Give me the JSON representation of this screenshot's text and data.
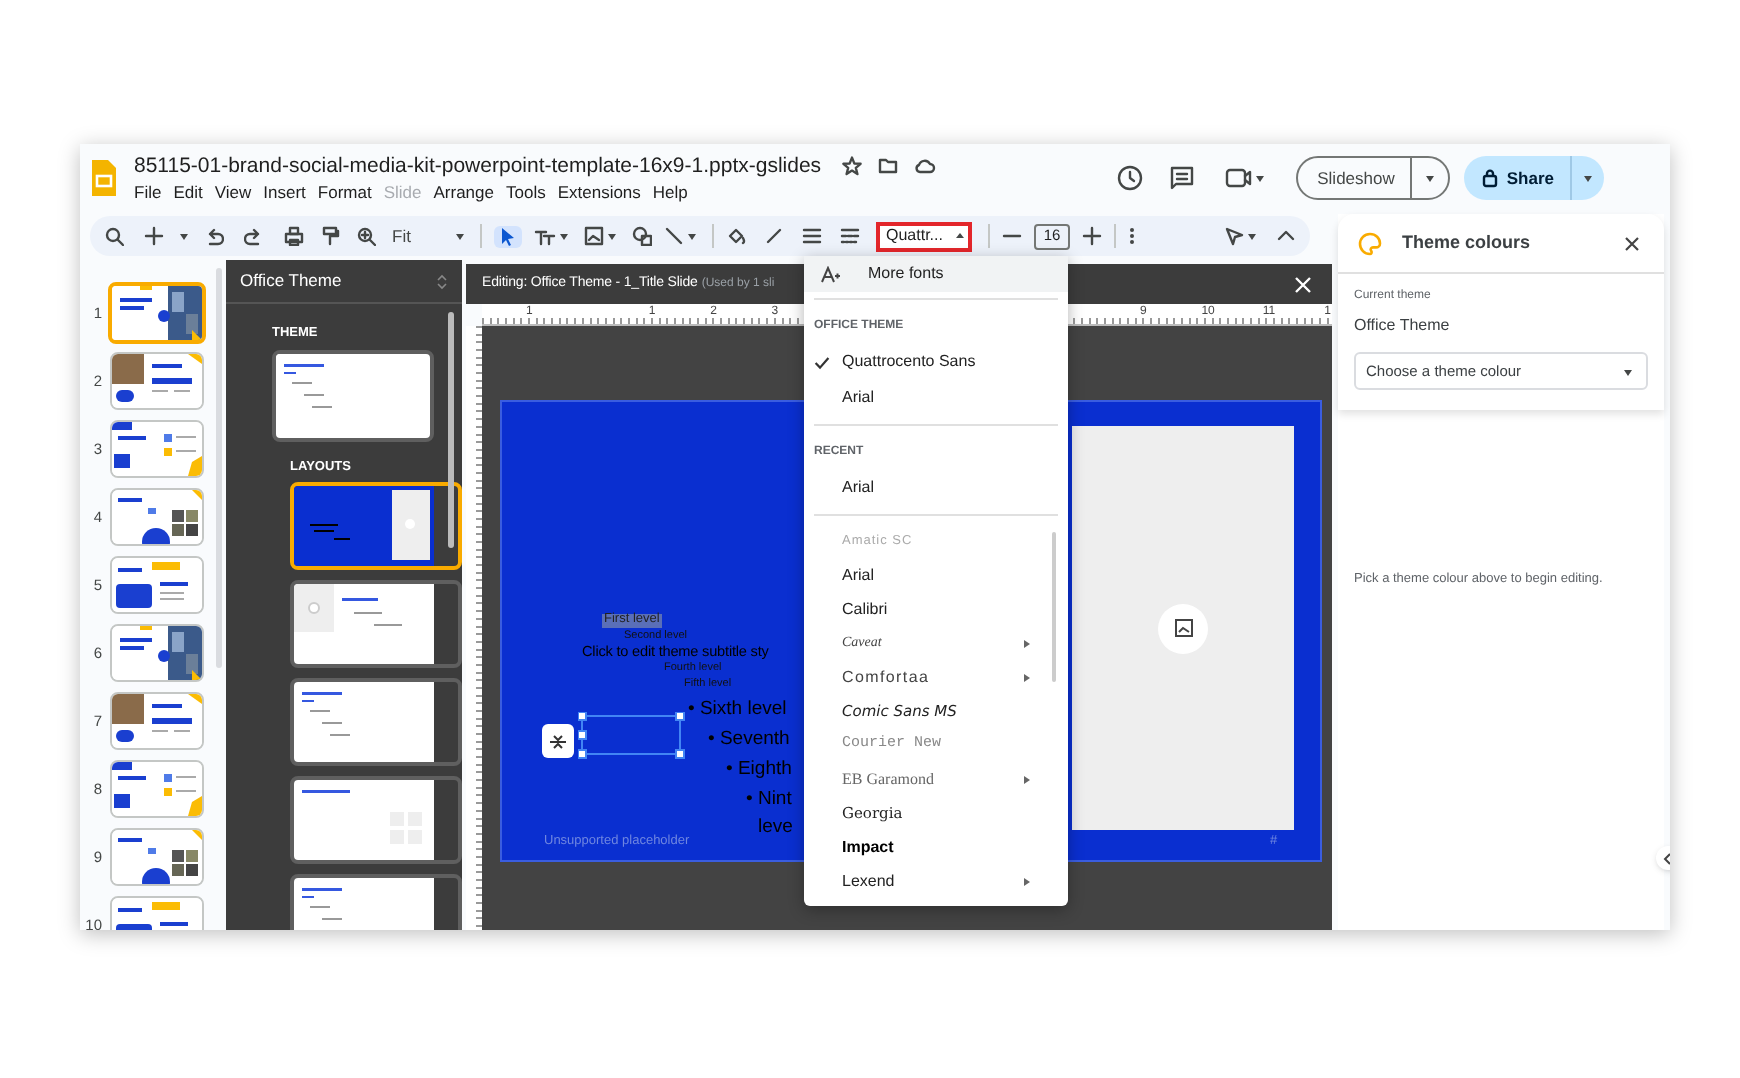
{
  "document": {
    "title": "85115-01-brand-social-media-kit-powerpoint-template-16x9-1.pptx-gslides",
    "menu": [
      {
        "label": "File",
        "disabled": false
      },
      {
        "label": "Edit",
        "disabled": false
      },
      {
        "label": "View",
        "disabled": false
      },
      {
        "label": "Insert",
        "disabled": false
      },
      {
        "label": "Format",
        "disabled": false
      },
      {
        "label": "Slide",
        "disabled": true
      },
      {
        "label": "Arrange",
        "disabled": false
      },
      {
        "label": "Tools",
        "disabled": false
      },
      {
        "label": "Extensions",
        "disabled": false
      },
      {
        "label": "Help",
        "disabled": false
      }
    ]
  },
  "header_actions": {
    "slideshow": "Slideshow",
    "share": "Share"
  },
  "toolbar": {
    "zoom": "Fit",
    "font": "Quattr...",
    "font_highlighted": true,
    "font_size": "16"
  },
  "slides": [
    {
      "number": "1",
      "selected": true
    },
    {
      "number": "2",
      "selected": false
    },
    {
      "number": "3",
      "selected": false
    },
    {
      "number": "4",
      "selected": false
    },
    {
      "number": "5",
      "selected": false
    },
    {
      "number": "6",
      "selected": false
    },
    {
      "number": "7",
      "selected": false
    },
    {
      "number": "8",
      "selected": false
    },
    {
      "number": "9",
      "selected": false
    },
    {
      "number": "10",
      "selected": false
    }
  ],
  "theme_panel": {
    "title": "Office Theme",
    "theme_heading": "THEME",
    "layouts_heading": "LAYOUTS",
    "layouts": [
      {
        "kind": "title-image",
        "selected": true
      },
      {
        "kind": "image-left",
        "selected": false
      },
      {
        "kind": "text",
        "selected": false
      },
      {
        "kind": "image-grid",
        "selected": false
      },
      {
        "kind": "text",
        "selected": false
      }
    ]
  },
  "editor": {
    "title": "Editing: Office Theme - 1_Title Slide",
    "note": "(Used by 1 sli",
    "ruler": [
      "1",
      "1",
      "2",
      "3",
      "9",
      "10",
      "11",
      "1"
    ],
    "slide_texts": [
      {
        "text": "First level",
        "kind": "highlighted"
      },
      {
        "text": "Second level",
        "kind": "tiny"
      },
      {
        "text": "Click to edit theme subtitle sty",
        "kind": "subtitle"
      },
      {
        "text": "Fourth level",
        "kind": "tiny"
      },
      {
        "text": "Fifth level",
        "kind": "tiny"
      },
      {
        "text": "• Sixth level",
        "kind": "large"
      },
      {
        "text": "• Seventh",
        "kind": "large"
      },
      {
        "text": "• Eighth",
        "kind": "large"
      },
      {
        "text": "• Nint",
        "kind": "large"
      },
      {
        "text": "leve",
        "kind": "large"
      }
    ],
    "placeholder_label": "Unsupported placeholder",
    "slide_number": "#"
  },
  "font_menu": {
    "more": "More fonts",
    "sections": [
      {
        "heading": "OFFICE THEME",
        "items": [
          {
            "label": "Quattrocento Sans",
            "checked": true
          },
          {
            "label": "Arial",
            "checked": false
          }
        ]
      },
      {
        "heading": "RECENT",
        "items": [
          {
            "label": "Arial",
            "checked": false
          }
        ]
      }
    ],
    "fonts": [
      {
        "label": "Amatic SC",
        "kind": "faded",
        "submenu": false
      },
      {
        "label": "Arial",
        "kind": "plain",
        "submenu": false
      },
      {
        "label": "Calibri",
        "kind": "plain",
        "submenu": false
      },
      {
        "label": "Caveat",
        "kind": "script",
        "submenu": true
      },
      {
        "label": "Comfortaa",
        "kind": "wide",
        "submenu": true
      },
      {
        "label": "Comic Sans MS",
        "kind": "italic",
        "submenu": false
      },
      {
        "label": "Courier New",
        "kind": "mono",
        "submenu": false
      },
      {
        "label": "EB Garamond",
        "kind": "serif",
        "submenu": true
      },
      {
        "label": "Georgia",
        "kind": "serif2",
        "submenu": false
      },
      {
        "label": "Impact",
        "kind": "bold",
        "submenu": false
      },
      {
        "label": "Lexend",
        "kind": "plain",
        "submenu": true
      }
    ]
  },
  "theme_colours": {
    "title": "Theme colours",
    "current_label": "Current theme",
    "current": "Office Theme",
    "select_placeholder": "Choose a theme colour",
    "hint": "Pick a theme colour above to begin editing."
  }
}
